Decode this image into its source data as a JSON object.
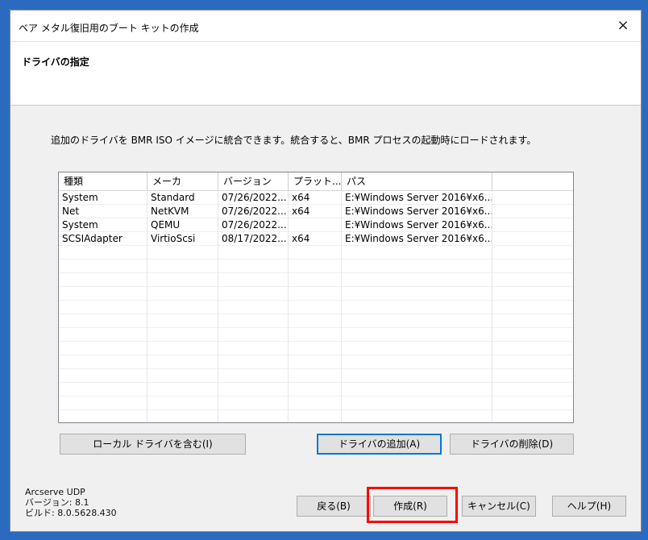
{
  "window": {
    "title": "ベア メタル復旧用のブート キットの作成",
    "close_icon": "×"
  },
  "header": {
    "title": "ドライバの指定"
  },
  "description": "追加のドライバを BMR ISO イメージに統合できます。統合すると、BMR プロセスの起動時にロードされます。",
  "table": {
    "columns": [
      "種類",
      "メーカ",
      "バージョン",
      "プラット...",
      "パス",
      ""
    ],
    "rows": [
      [
        "System",
        "Standard",
        "07/26/2022...",
        "x64",
        "E:¥Windows Server 2016¥x6..."
      ],
      [
        "Net",
        "NetKVM",
        "07/26/2022...",
        "x64",
        "E:¥Windows Server 2016¥x6..."
      ],
      [
        "System",
        "QEMU",
        "07/26/2022...",
        "",
        "E:¥Windows Server 2016¥x6..."
      ],
      [
        "SCSIAdapter",
        "VirtioScsi",
        "08/17/2022...",
        "x64",
        "E:¥Windows Server 2016¥x6..."
      ]
    ]
  },
  "buttons": {
    "include_local": "ローカル ドライバを含む(I)",
    "add_driver": "ドライバの追加(A)",
    "delete_driver": "ドライバの削除(D)",
    "back": "戻る(B)",
    "create": "作成(R)",
    "cancel": "キャンセル(C)",
    "help": "ヘルプ(H)"
  },
  "footer": {
    "product": "Arcserve UDP",
    "version": "バージョン: 8.1",
    "build": "ビルド: 8.0.5628.430"
  },
  "colors": {
    "desktop": "#2a6bbf",
    "highlight": "#ff0000",
    "default_button": "#0078d7"
  }
}
